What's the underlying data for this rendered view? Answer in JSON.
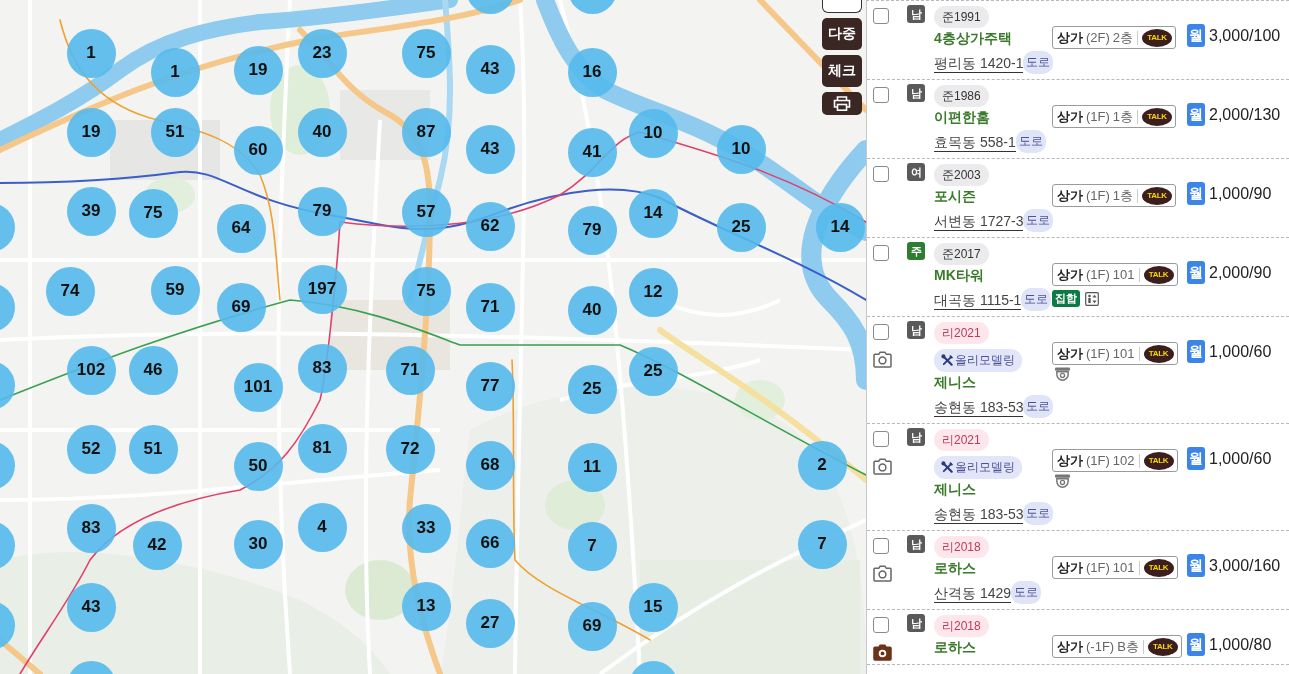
{
  "map": {
    "controls": [
      {
        "kind": "blank"
      },
      {
        "kind": "text",
        "label": "다중"
      },
      {
        "kind": "text",
        "label": "체크"
      },
      {
        "kind": "print"
      }
    ],
    "clusters": [
      {
        "count": "1"
      },
      {
        "count": "1"
      },
      {
        "count": "19"
      },
      {
        "count": "23"
      },
      {
        "count": "75"
      },
      {
        "count": "43"
      },
      {
        "count": "16"
      },
      {
        "count": "19"
      },
      {
        "count": "51"
      },
      {
        "count": "60"
      },
      {
        "count": "40"
      },
      {
        "count": "87"
      },
      {
        "count": "43"
      },
      {
        "count": "41"
      },
      {
        "count": "10"
      },
      {
        "count": "10"
      },
      {
        "count": "39"
      },
      {
        "count": "75"
      },
      {
        "count": "64"
      },
      {
        "count": "79"
      },
      {
        "count": "57"
      },
      {
        "count": "62"
      },
      {
        "count": "79"
      },
      {
        "count": "14"
      },
      {
        "count": "25"
      },
      {
        "count": "14"
      },
      {
        "count": "74"
      },
      {
        "count": "59"
      },
      {
        "count": "69"
      },
      {
        "count": "197"
      },
      {
        "count": "75"
      },
      {
        "count": "71"
      },
      {
        "count": "40"
      },
      {
        "count": "12"
      },
      {
        "count": "102"
      },
      {
        "count": "46"
      },
      {
        "count": "101"
      },
      {
        "count": "83"
      },
      {
        "count": "71"
      },
      {
        "count": "77"
      },
      {
        "count": "25"
      },
      {
        "count": "25"
      },
      {
        "count": "52"
      },
      {
        "count": "51"
      },
      {
        "count": "50"
      },
      {
        "count": "81"
      },
      {
        "count": "72"
      },
      {
        "count": "68"
      },
      {
        "count": "11"
      },
      {
        "count": "2"
      },
      {
        "count": "83"
      },
      {
        "count": "42"
      },
      {
        "count": "30"
      },
      {
        "count": "4"
      },
      {
        "count": "33"
      },
      {
        "count": "66"
      },
      {
        "count": "7"
      },
      {
        "count": "7"
      },
      {
        "count": "43"
      },
      {
        "count": "13"
      },
      {
        "count": "27"
      },
      {
        "count": "69"
      },
      {
        "count": "15"
      }
    ]
  },
  "listings": [
    {
      "checked": false,
      "badge": {
        "text": "남",
        "color": "#5a5a5a"
      },
      "year_tag": {
        "kind": "approval",
        "text": "준1991"
      },
      "name": "4층상가주택",
      "address": "평리동 1420-1",
      "road_tag": "도로",
      "use": "상가",
      "floor": "(2F)",
      "unit": "2층",
      "talk": "TALK",
      "price_type": "월",
      "price": "3,000/100"
    },
    {
      "checked": false,
      "badge": {
        "text": "남",
        "color": "#5a5a5a"
      },
      "year_tag": {
        "kind": "approval",
        "text": "준1986"
      },
      "name": "이편한홈",
      "address": "효목동 558-1",
      "road_tag": "도로",
      "use": "상가",
      "floor": "(1F)",
      "unit": "1층",
      "talk": "TALK",
      "price_type": "월",
      "price": "2,000/130"
    },
    {
      "checked": false,
      "badge": {
        "text": "여",
        "color": "#5a5a5a"
      },
      "year_tag": {
        "kind": "approval",
        "text": "준2003"
      },
      "name": "포시즌",
      "address": "서변동 1727-3",
      "road_tag": "도로",
      "use": "상가",
      "floor": "(1F)",
      "unit": "1층",
      "talk": "TALK",
      "price_type": "월",
      "price": "1,000/90"
    },
    {
      "checked": false,
      "badge": {
        "text": "주",
        "color": "#2e7d32"
      },
      "year_tag": {
        "kind": "approval",
        "text": "준2017"
      },
      "name": "MK타워",
      "address": "대곡동 1115-1",
      "road_tag": "도로",
      "use": "상가",
      "floor": "(1F)",
      "unit": "101",
      "talk": "TALK",
      "features": [
        {
          "kind": "tag",
          "text": "집합"
        },
        {
          "kind": "elevator"
        }
      ],
      "price_type": "월",
      "price": "2,000/90"
    },
    {
      "checked": false,
      "camera": {
        "filled": false
      },
      "badge": {
        "text": "남",
        "color": "#5a5a5a"
      },
      "year_tag": {
        "kind": "remodel",
        "text": "리2021"
      },
      "remodel": "올리모델링",
      "name": "제니스",
      "address": "송현동 183-53",
      "road_tag": "도로",
      "use": "상가",
      "floor": "(1F)",
      "unit": "101",
      "talk": "TALK",
      "features": [
        {
          "kind": "cctv"
        }
      ],
      "price_type": "월",
      "price": "1,000/60"
    },
    {
      "checked": false,
      "camera": {
        "filled": false
      },
      "badge": {
        "text": "남",
        "color": "#5a5a5a"
      },
      "year_tag": {
        "kind": "remodel",
        "text": "리2021"
      },
      "remodel": "올리모델링",
      "name": "제니스",
      "address": "송현동 183-53",
      "road_tag": "도로",
      "use": "상가",
      "floor": "(1F)",
      "unit": "102",
      "talk": "TALK",
      "features": [
        {
          "kind": "cctv"
        }
      ],
      "price_type": "월",
      "price": "1,000/60"
    },
    {
      "checked": false,
      "camera": {
        "filled": false
      },
      "badge": {
        "text": "남",
        "color": "#5a5a5a"
      },
      "year_tag": {
        "kind": "remodel",
        "text": "리2018"
      },
      "name": "로하스",
      "address": "산격동 1429",
      "road_tag": "도로",
      "use": "상가",
      "floor": "(1F)",
      "unit": "101",
      "talk": "TALK",
      "price_type": "월",
      "price": "3,000/160"
    },
    {
      "checked": false,
      "camera": {
        "filled": true
      },
      "badge": {
        "text": "남",
        "color": "#5a5a5a"
      },
      "year_tag": {
        "kind": "remodel",
        "text": "리2018"
      },
      "name": "로하스",
      "use": "상가",
      "floor": "(-1F)",
      "unit": "B층",
      "talk": "TALK",
      "price_type": "월",
      "price": "1,000/80"
    }
  ]
}
